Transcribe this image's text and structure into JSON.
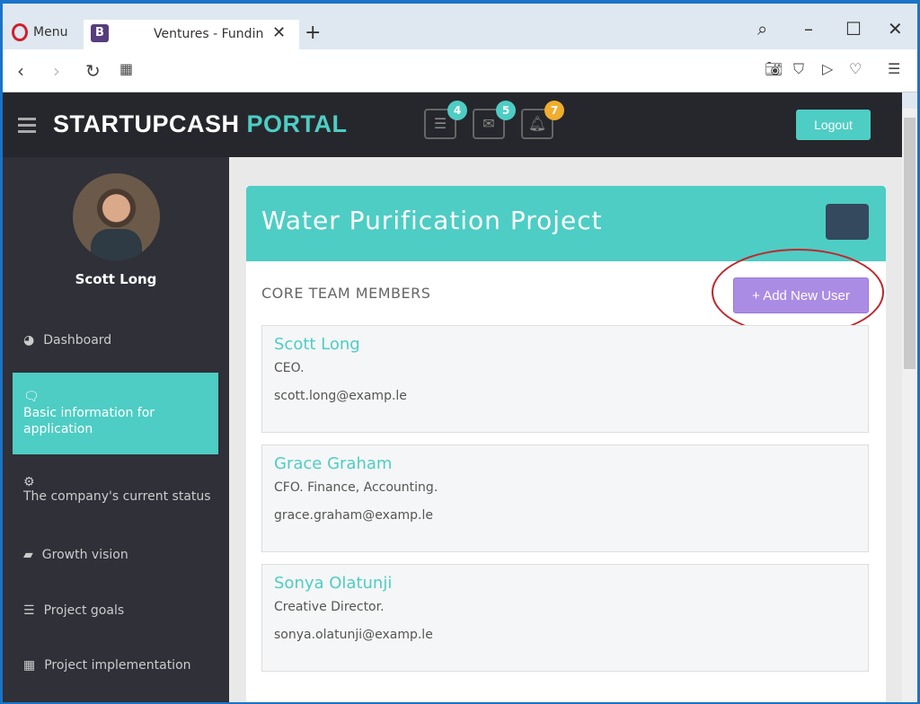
{
  "browser": {
    "menu_label": "Menu",
    "tab_title": "Ventures - Funding",
    "tab_favicon": "B"
  },
  "header": {
    "brand_main": "STARTUPCASH",
    "brand_accent": "PORTAL",
    "badges": {
      "tasks": "4",
      "messages": "5",
      "notifications": "7"
    },
    "logout_label": "Logout",
    "accent_color": "#4ecdc4"
  },
  "sidebar": {
    "user_name": "Scott Long",
    "items": [
      {
        "label": "Dashboard",
        "icon": "dashboard-icon"
      },
      {
        "label": "Basic information for application",
        "icon": "comments-icon",
        "active": true
      },
      {
        "label": "The company's current status",
        "icon": "gears-icon"
      },
      {
        "label": "Growth vision",
        "icon": "book-icon"
      },
      {
        "label": "Project goals",
        "icon": "server-icon"
      },
      {
        "label": "Project implementation",
        "icon": "grid-icon"
      }
    ]
  },
  "main": {
    "title": "Water Purification Project",
    "section_title": "CORE TEAM MEMBERS",
    "add_user_label": "+ Add New User",
    "members": [
      {
        "name": "Scott Long",
        "role": "CEO.",
        "email": "scott.long@examp.le"
      },
      {
        "name": "Grace Graham",
        "role": "CFO. Finance, Accounting.",
        "email": "grace.graham@examp.le"
      },
      {
        "name": "Sonya Olatunji",
        "role": "Creative Director.",
        "email": "sonya.olatunji@examp.le"
      }
    ]
  }
}
